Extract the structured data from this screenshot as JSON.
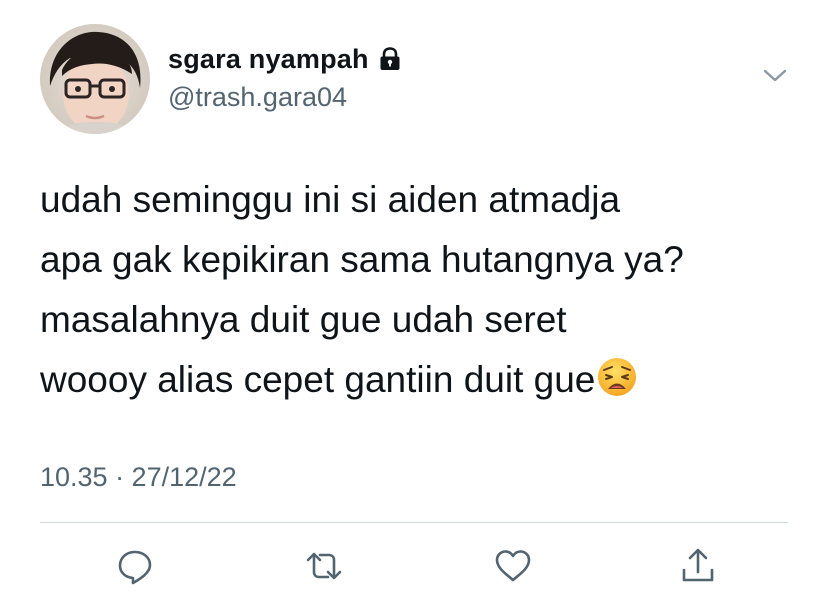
{
  "user": {
    "display_name": "sgara nyampah",
    "handle": "@trash.gara04",
    "protected_icon": "lock-icon",
    "avatar": "avatar"
  },
  "tweet": {
    "lines": [
      "udah seminggu ini si aiden atmadja",
      "apa gak kepikiran sama hutangnya ya?",
      "masalahnya duit gue udah seret",
      "woooy alias cepet gantiin duit gue"
    ],
    "emoji": "weary-face-emoji",
    "timestamp": "10.35 · 27/12/22"
  },
  "actions": [
    {
      "name": "reply-button",
      "icon": "reply-icon"
    },
    {
      "name": "retweet-button",
      "icon": "retweet-icon"
    },
    {
      "name": "like-button",
      "icon": "heart-icon"
    },
    {
      "name": "share-button",
      "icon": "share-icon"
    }
  ],
  "colors": {
    "text": "#0f1419",
    "secondary": "#536471",
    "divider": "#cfd9de",
    "icon": "#536471"
  }
}
